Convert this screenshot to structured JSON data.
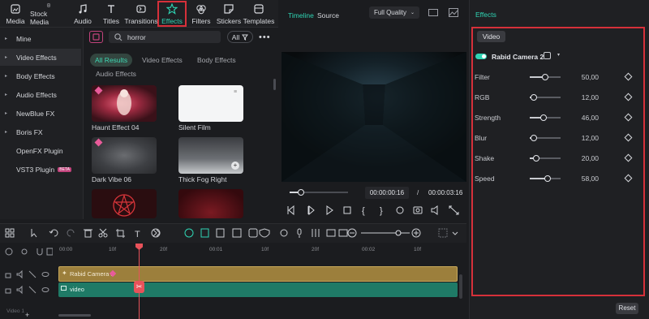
{
  "toolbar": {
    "items": [
      {
        "label": "Media",
        "icon": "media-icon"
      },
      {
        "label": "Stock Media",
        "icon": "stock-media-icon"
      },
      {
        "label": "Audio",
        "icon": "audio-icon"
      },
      {
        "label": "Titles",
        "icon": "titles-icon"
      },
      {
        "label": "Transitions",
        "icon": "transitions-icon"
      },
      {
        "label": "Effects",
        "icon": "effects-icon"
      },
      {
        "label": "Filters",
        "icon": "filters-icon"
      },
      {
        "label": "Stickers",
        "icon": "stickers-icon"
      },
      {
        "label": "Templates",
        "icon": "templates-icon"
      }
    ],
    "active": "Effects"
  },
  "left_nav": {
    "items": [
      {
        "label": "Mine",
        "caret": "▸"
      },
      {
        "label": "Video Effects",
        "caret": "▸"
      },
      {
        "label": "Body Effects",
        "caret": "▸"
      },
      {
        "label": "Audio Effects",
        "caret": "▸"
      },
      {
        "label": "NewBlue FX",
        "caret": "▸"
      },
      {
        "label": "Boris FX",
        "caret": "▸"
      },
      {
        "label": "OpenFX Plugin",
        "caret": ""
      },
      {
        "label": "VST3 Plugin",
        "caret": "",
        "badge": "BETA"
      }
    ]
  },
  "library": {
    "search_value": "horror",
    "filter_all": "All",
    "tabs": [
      "All Results",
      "Video Effects",
      "Body Effects",
      "Audio Effects"
    ],
    "items": [
      {
        "label": "Haunt Effect 04"
      },
      {
        "label": "Silent Film"
      },
      {
        "label": "Dark Vibe 06"
      },
      {
        "label": "Thick Fog Right"
      },
      {
        "label": ""
      },
      {
        "label": ""
      }
    ]
  },
  "preview": {
    "tab_timeline": "Timeline",
    "tab_source": "Source",
    "quality": "Full Quality",
    "current_time": "00:00:00:16",
    "separator": "/",
    "total_time": "00:00:03:16",
    "progress_fraction": 0.19
  },
  "effects_panel": {
    "title": "Effects",
    "tab": "Video",
    "effect_name": "Rabid Camera 2",
    "params": [
      {
        "label": "Filter",
        "value": "50,00",
        "fraction": 0.5
      },
      {
        "label": "RGB",
        "value": "12,00",
        "fraction": 0.12
      },
      {
        "label": "Strength",
        "value": "46,00",
        "fraction": 0.46
      },
      {
        "label": "Blur",
        "value": "12,00",
        "fraction": 0.12
      },
      {
        "label": "Shake",
        "value": "20,00",
        "fraction": 0.2
      },
      {
        "label": "Speed",
        "value": "58,00",
        "fraction": 0.58
      }
    ],
    "reset_label": "Reset"
  },
  "timeline": {
    "ruler_ticks": [
      "00:00",
      "10f",
      "20f",
      "00:01",
      "10f",
      "20f",
      "00:02",
      "10f"
    ],
    "tracks": [
      {
        "label": "Rabid Camera 2"
      },
      {
        "label": "video"
      }
    ],
    "track_name": "Video 1"
  },
  "colors": {
    "accent": "#2fd5b4",
    "highlight_box": "#d6303a",
    "playhead": "#e8525a",
    "effect_clip": "#9c7f3c",
    "video_clip": "#1f7a66"
  }
}
